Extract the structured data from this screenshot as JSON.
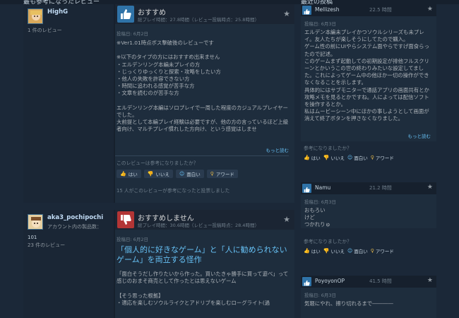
{
  "sections": {
    "left_title": "最も参考になったレビュー",
    "right_title": "最近の投稿"
  },
  "reviews": [
    {
      "author": "HighG",
      "author_count": "1 件のレビュー",
      "verdict": "おすすめ",
      "hours": "総プレイ時間：27.8時間（レビュー投稿時点：25.8時間）",
      "posted": "投稿日: 6月2日",
      "text": "※Ver1.01時点ボス撃破後のレビューです\n\n※以下のタイプの方にはおすすめ出来ません\n・エルデンリング本編未プレイの方\n・じっくりゆっくりと探索・攻略をしたい方\n・他人の失敗を許容できない方\n・時間に追われる感覚が苦手な方\n・文章を読むのが苦手な方\n\nエルデンリング本編はソロプレイで一周した程度のカジュアルプレイヤーでした。\n大前提として本編プレイ経験は必要ですが、他の方の言っているほど上級者向け、マルチプレイ慣れした方向け、という感覚はしませ",
      "more": "もっと読む",
      "helpful_q": "このレビューは参考になりましたか？",
      "buttons": {
        "yes": "はい",
        "no": "いいえ",
        "funny": "面白い",
        "award": "アワード"
      },
      "found": "15 人がこのレビューが参考になったと投票しました"
    },
    {
      "author": "aka3_pochipochi",
      "author_sub": "アカウント内の製品数：",
      "author_products": "101",
      "author_count": "23 件のレビュー",
      "verdict": "おすすめしません",
      "hours": "総プレイ時間：30.6時間（レビュー投稿時点：28.4時間）",
      "posted": "投稿日: 6月2日",
      "headline": "「個人的に好きなゲーム」と「人に勧められないゲーム」を両立する怪作",
      "text": "「面白そうだし作りたいから作った。買いたきゃ勝手に買って遊べ」って感じのおまそ商売として作ったとは思えないゲーム\n\n【そう思った根拠】\n・適応を楽しむソウルライクとアドリブを楽しむローグライト(過"
    }
  ],
  "recent": [
    {
      "name": "Mellizesh",
      "hours": "22.5 時間",
      "posted": "投稿日: 6月3日",
      "text": "エルデン本編未プレイかつソウルシリーズも未プレイ。友人たちが楽しそうにしてたので購入。\nゲーム性の前にUIやらシステム面やらですげ面食らったので記述。\nこのゲームまず起動しての初期設定が排他フルスクリーンとかいうこの世の終わりみたいな設定してました。これによってゲーム中の他ほか一切の操作ができなくなることを示します。\n具体的にはサブモニターで通話アプリの画面共有とか攻略メモを見るとかですね。人によっては配信ソフトを操作するとか。\n私はムービーシーン中にほかの事しようとして画面が消えて終了ボタンを押さなくなりました。",
      "more": "もっと読む",
      "helpful_q": "参考になりましたか？",
      "buttons": {
        "yes": "はい",
        "no": "いいえ",
        "funny": "面白い",
        "award": "アワード"
      }
    },
    {
      "name": "Namu",
      "hours": "21.2 時間",
      "posted": "投稿日: 6月3日",
      "text": "おもろい\nけど\nつかれりゅ",
      "helpful_q": "参考になりましたか？",
      "buttons": {
        "yes": "はい",
        "no": "いいえ",
        "funny": "面白い",
        "award": "アワード"
      }
    },
    {
      "name": "PoyoyonOP",
      "hours": "41.5 時間",
      "posted": "投稿日: 6月3日",
      "text": "気軽にやれ、擦り切れるまで――――"
    }
  ]
}
